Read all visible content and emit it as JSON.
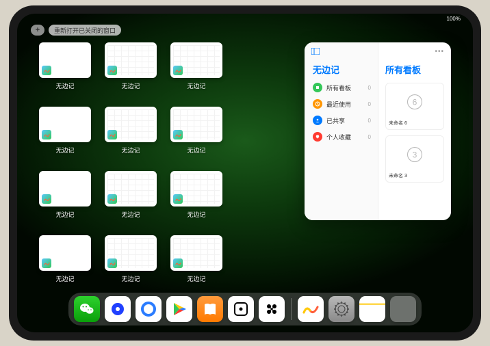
{
  "status": {
    "left": "",
    "right": "100%"
  },
  "top": {
    "plus": "+",
    "reopen": "重新打开已关闭的窗口"
  },
  "app_tile": {
    "label": "无边记",
    "thumbs": [
      {
        "type": "blank"
      },
      {
        "type": "grid"
      },
      {
        "type": "grid"
      },
      {
        "type": "blank"
      },
      {
        "type": "grid"
      },
      {
        "type": "grid"
      },
      {
        "type": "blank"
      },
      {
        "type": "grid"
      },
      {
        "type": "grid"
      },
      {
        "type": "blank"
      },
      {
        "type": "grid"
      },
      {
        "type": "grid"
      }
    ]
  },
  "card": {
    "sidebar_title": "无边记",
    "items": [
      {
        "label": "所有看板",
        "count": "0",
        "color": "#34c759"
      },
      {
        "label": "最近使用",
        "count": "0",
        "color": "#ff9500"
      },
      {
        "label": "已共享",
        "count": "0",
        "color": "#007aff"
      },
      {
        "label": "个人收藏",
        "count": "0",
        "color": "#ff3b30"
      }
    ],
    "boards_title": "所有看板",
    "boards": [
      {
        "name": "未命名 6",
        "sub": ""
      },
      {
        "name": "未命名 3",
        "sub": ""
      }
    ],
    "digits": [
      "6",
      "3"
    ]
  },
  "dock": {
    "apps": [
      {
        "name": "wechat",
        "bg": "linear-gradient(#2dd12d,#0a9f0a)"
      },
      {
        "name": "quark",
        "bg": "#fff",
        "inner": "#2040ff"
      },
      {
        "name": "qqbrowser",
        "bg": "#fff",
        "inner": "#2a7cff"
      },
      {
        "name": "play",
        "bg": "#fff"
      },
      {
        "name": "books",
        "bg": "linear-gradient(#ff9a3c,#ff7a00)"
      },
      {
        "name": "dice",
        "bg": "#fff"
      },
      {
        "name": "connect",
        "bg": "#fff"
      }
    ],
    "recent": [
      {
        "name": "freeform",
        "bg": "#fff"
      },
      {
        "name": "settings",
        "bg": "linear-gradient(#b8b8b8,#8a8a8a)"
      },
      {
        "name": "notes",
        "bg": "linear-gradient(#fff 0%,#fff 28%,#ffd84d 28%,#ffd84d 34%,#fff 34%)"
      }
    ]
  }
}
